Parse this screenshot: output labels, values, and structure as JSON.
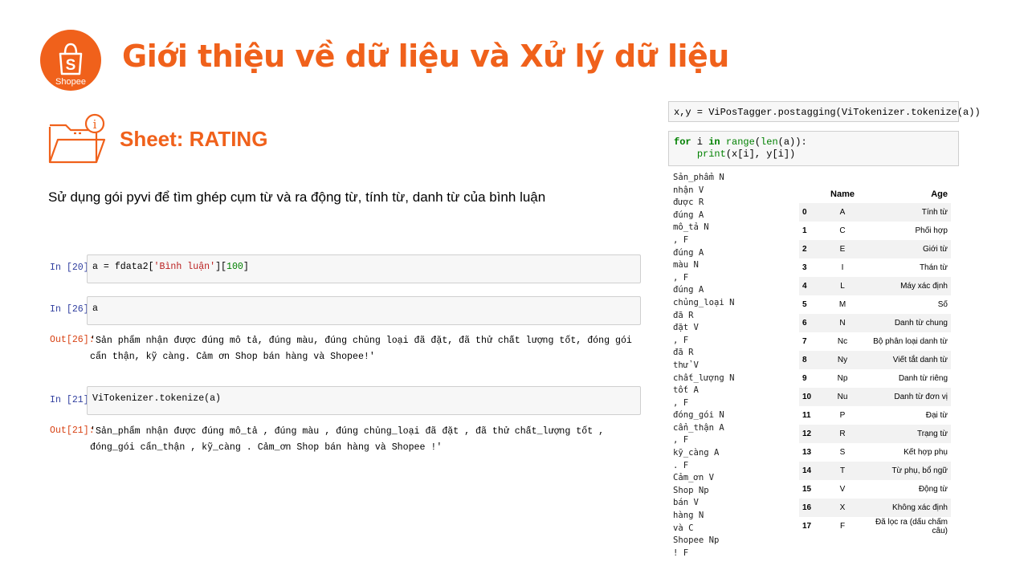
{
  "header": {
    "title": "Giới thiệu về dữ liệu và Xử lý dữ liệu",
    "logo_text": "Shopee",
    "logo_mark": "S"
  },
  "section": {
    "title": "Sheet: RATING",
    "icon_glyph": "i",
    "description": "Sử dụng gói pyvi để tìm ghép cụm từ và  ra động từ, tính từ, danh từ của bình luận"
  },
  "notebook": {
    "cells": [
      {
        "prompt": "In [20]:",
        "code_var": "a = fdata2[",
        "code_str": "'Bình luận'",
        "code_mid": "][",
        "code_num": "100",
        "code_end": "]"
      },
      {
        "prompt": "In [26]:",
        "code": "a"
      },
      {
        "prompt": "Out[26]:",
        "output": "'Sản phẩm nhận được đúng mô tả, đúng màu, đúng chủng loại đã đặt, đã thử chất lượng tốt, đóng gói cẩn thận, kỹ càng. Cảm ơn Shop bán hàng và Shopee!'"
      },
      {
        "prompt": "In [21]:",
        "code": "ViTokenizer.tokenize(a)"
      },
      {
        "prompt": "Out[21]:",
        "output": "'Sản_phẩm nhận được đúng mô_tả , đúng màu , đúng chủng_loại đã đặt , đã thử chất_lượng tốt , đóng_gói cẩn_thận , kỹ_càng . Cảm_ơn Shop bán hàng và Shopee !'"
      }
    ]
  },
  "right_panel": {
    "code1": "x,y = ViPosTagger.postagging(ViTokenizer.tokenize(a))",
    "code2_kw1": "for",
    "code2_a": " i ",
    "code2_kw2": "in",
    "code2_b": " ",
    "code2_fn1": "range",
    "code2_c": "(",
    "code2_fn2": "len",
    "code2_d": "(a)):",
    "code2_indent": "    ",
    "code2_fn3": "print",
    "code2_e": "(x[i], y[i])",
    "tags": [
      "Sản_phẩm N",
      "nhận V",
      "được R",
      "đúng A",
      "mô_tả N",
      ", F",
      "đúng A",
      "màu N",
      ", F",
      "đúng A",
      "chủng_loại N",
      "đã R",
      "đặt V",
      ", F",
      "đã R",
      "thử V",
      "chất_lượng N",
      "tốt A",
      ", F",
      "đóng_gói N",
      "cẩn_thận A",
      ", F",
      "kỹ_càng A",
      ". F",
      "Cảm_ơn V",
      "Shop Np",
      "bán V",
      "hàng N",
      "và C",
      "Shopee Np",
      "! F"
    ]
  },
  "pos_table": {
    "headers": [
      "",
      "Name",
      "Age"
    ],
    "rows": [
      [
        "0",
        "A",
        "Tính từ"
      ],
      [
        "1",
        "C",
        "Phối hợp"
      ],
      [
        "2",
        "E",
        "Giới từ"
      ],
      [
        "3",
        "I",
        "Thán từ"
      ],
      [
        "4",
        "L",
        "Máy xác định"
      ],
      [
        "5",
        "M",
        "Số"
      ],
      [
        "6",
        "N",
        "Danh từ chung"
      ],
      [
        "7",
        "Nc",
        "Bộ phân loại danh từ"
      ],
      [
        "8",
        "Ny",
        "Viết tắt danh từ"
      ],
      [
        "9",
        "Np",
        "Danh từ riêng"
      ],
      [
        "10",
        "Nu",
        "Danh từ đơn vị"
      ],
      [
        "11",
        "P",
        "Đại từ"
      ],
      [
        "12",
        "R",
        "Trạng từ"
      ],
      [
        "13",
        "S",
        "Kết hợp phụ"
      ],
      [
        "14",
        "T",
        "Từ phụ, bổ ngữ"
      ],
      [
        "15",
        "V",
        "Động từ"
      ],
      [
        "16",
        "X",
        "Không xác định"
      ],
      [
        "17",
        "F",
        "Đã lọc ra (dấu chấm câu)"
      ]
    ]
  },
  "colors": {
    "accent": "#f0611b",
    "prompt_in": "#303f9f",
    "prompt_out": "#d84315"
  }
}
